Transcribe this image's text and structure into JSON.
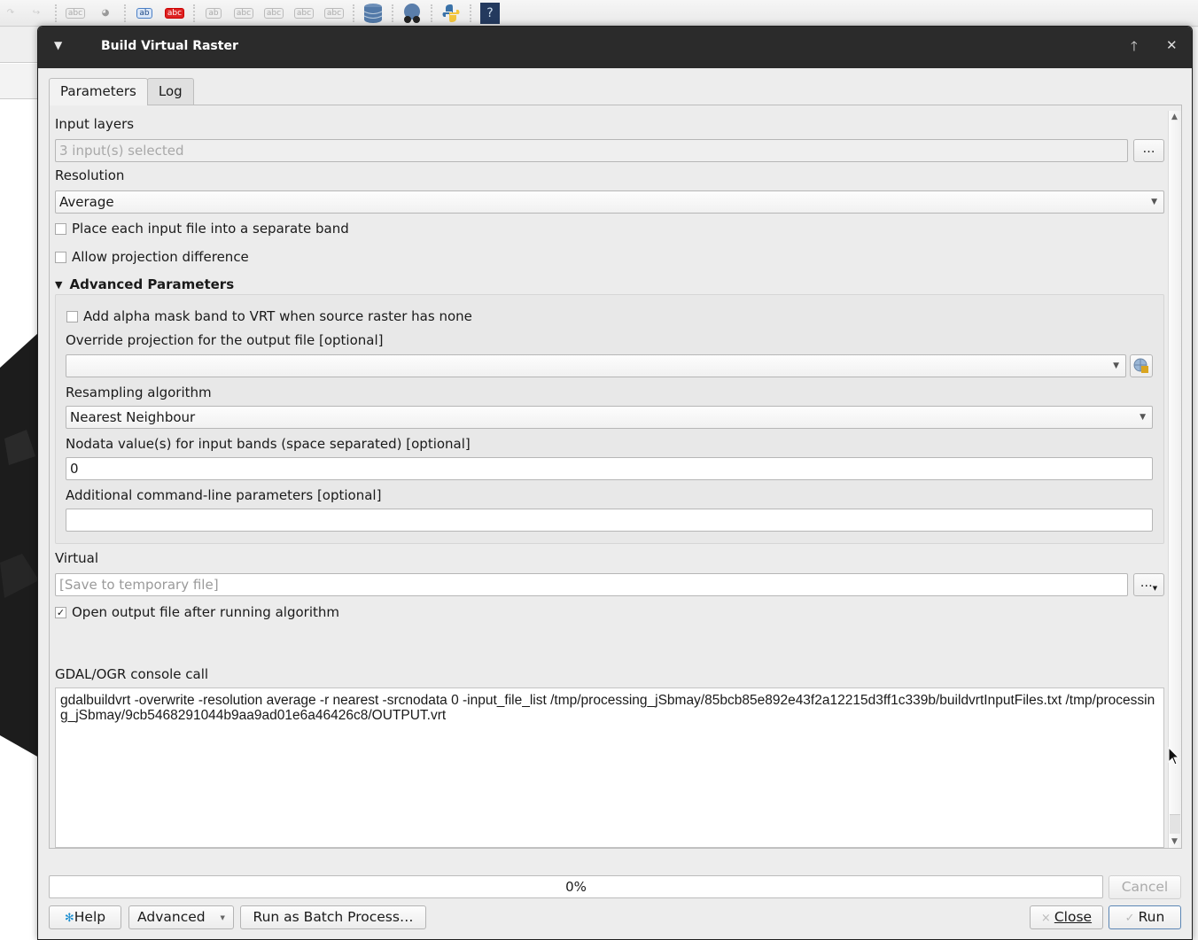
{
  "dialog": {
    "title": "Build Virtual Raster",
    "menu_icon": "▼",
    "shade_icon": "🡑",
    "close_icon": "✕"
  },
  "tabs": [
    {
      "label": "Parameters",
      "active": true
    },
    {
      "label": "Log",
      "active": false
    }
  ],
  "params": {
    "input_layers_label": "Input layers",
    "input_layers_value": "3 input(s) selected",
    "browse_label": "…",
    "resolution_label": "Resolution",
    "resolution_value": "Average",
    "separate_band_label": "Place each input file into a separate band",
    "separate_band_checked": false,
    "allow_projection_label": "Allow projection difference",
    "allow_projection_checked": false,
    "advanced_header": "Advanced Parameters",
    "alpha_mask_label": "Add alpha mask band to VRT when source raster has none",
    "alpha_mask_checked": false,
    "override_projection_label": "Override projection for the output file [optional]",
    "override_projection_value": "",
    "resampling_label": "Resampling algorithm",
    "resampling_value": "Nearest Neighbour",
    "nodata_label": "Nodata value(s) for input bands (space separated) [optional]",
    "nodata_value": "0",
    "extra_label": "Additional command-line parameters [optional]",
    "extra_value": "",
    "virtual_label": "Virtual",
    "virtual_placeholder": "[Save to temporary file]",
    "open_output_label": "Open output file after running algorithm",
    "open_output_checked": true,
    "open_output_mark": "✓",
    "console_label": "GDAL/OGR console call",
    "console_text": "gdalbuildvrt -overwrite -resolution average -r nearest -srcnodata 0 -input_file_list /tmp/processing_jSbmay/85bcb85e892e43f2a12215d3ff1c339b/buildvrtInputFiles.txt /tmp/processing_jSbmay/9cb5468291044b9aa9ad01e6a46426c8/OUTPUT.vrt"
  },
  "progress": {
    "value_percent": 0,
    "text": "0%"
  },
  "buttons": {
    "cancel": "Cancel",
    "help": "Help",
    "advanced": "Advanced",
    "batch": "Run as Batch Process…",
    "close": "Close",
    "run": "Run",
    "close_icon": "×",
    "run_icon": "✓"
  },
  "colors": {
    "titlebar": "#2b2b2b",
    "default_button_border": "#5b86b5"
  }
}
